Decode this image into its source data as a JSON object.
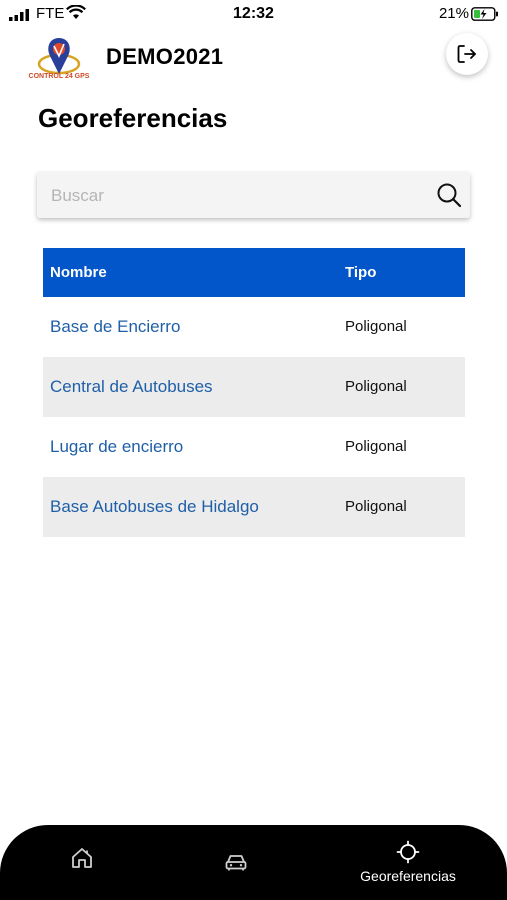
{
  "status": {
    "carrier": "FTE",
    "time": "12:32",
    "battery": "21%"
  },
  "header": {
    "app_title": "DEMO2021",
    "logo_text": "CONTROL 24 GPS",
    "logout_icon": "logout-icon"
  },
  "page": {
    "title": "Georeferencias"
  },
  "search": {
    "placeholder": "Buscar",
    "value": "",
    "icon": "search-icon"
  },
  "table": {
    "headers": [
      "Nombre",
      "Tipo"
    ],
    "rows": [
      {
        "name": "Base de Encierro",
        "tipo": "Poligonal"
      },
      {
        "name": "Central de Autobuses",
        "tipo": "Poligonal"
      },
      {
        "name": "Lugar de encierro",
        "tipo": "Poligonal"
      },
      {
        "name": "Base Autobuses de Hidalgo",
        "tipo": "Poligonal"
      }
    ]
  },
  "tabbar": {
    "tabs": [
      {
        "icon": "home-icon",
        "label": ""
      },
      {
        "icon": "car-icon",
        "label": ""
      },
      {
        "icon": "crosshair-icon",
        "label": "Georeferencias",
        "active": true
      }
    ]
  },
  "colors": {
    "accent": "#0356c9",
    "link": "#1f5fa8",
    "row_alt": "#ececec",
    "tabbar": "#000000"
  }
}
